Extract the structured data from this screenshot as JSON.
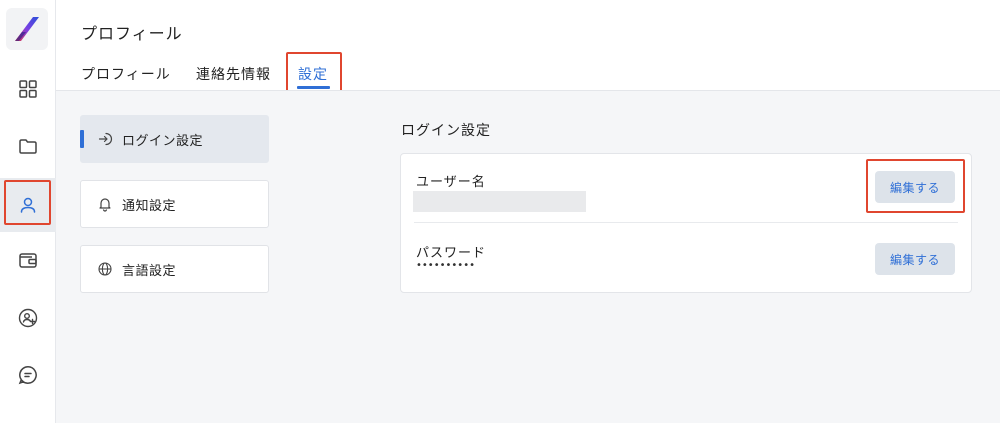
{
  "header": {
    "title": "プロフィール",
    "tabs": [
      {
        "label": "プロフィール",
        "active": false
      },
      {
        "label": "連絡先情報",
        "active": false
      },
      {
        "label": "設定",
        "active": true
      }
    ]
  },
  "sidebar": {
    "items": [
      {
        "icon": "dashboard-grid-icon",
        "active": false
      },
      {
        "icon": "folder-icon",
        "active": false
      },
      {
        "icon": "user-icon",
        "active": true
      },
      {
        "icon": "wallet-icon",
        "active": false
      },
      {
        "icon": "add-user-icon",
        "active": false
      },
      {
        "icon": "chat-icon",
        "active": false
      }
    ]
  },
  "settings_menu": {
    "items": [
      {
        "label": "ログイン設定",
        "icon": "login-icon",
        "active": true
      },
      {
        "label": "通知設定",
        "icon": "bell-icon",
        "active": false
      },
      {
        "label": "言語設定",
        "icon": "globe-icon",
        "active": false
      }
    ]
  },
  "login_settings": {
    "title": "ログイン設定",
    "username": {
      "label": "ユーザー名",
      "value": "",
      "edit_label": "編集する"
    },
    "password": {
      "label": "パスワード",
      "value": "••••••••••",
      "edit_label": "編集する"
    }
  },
  "colors": {
    "accent": "#2f6fd6",
    "highlight": "#e0462f",
    "main_bg": "#f5f6f8",
    "button_bg": "#dde3ea"
  }
}
